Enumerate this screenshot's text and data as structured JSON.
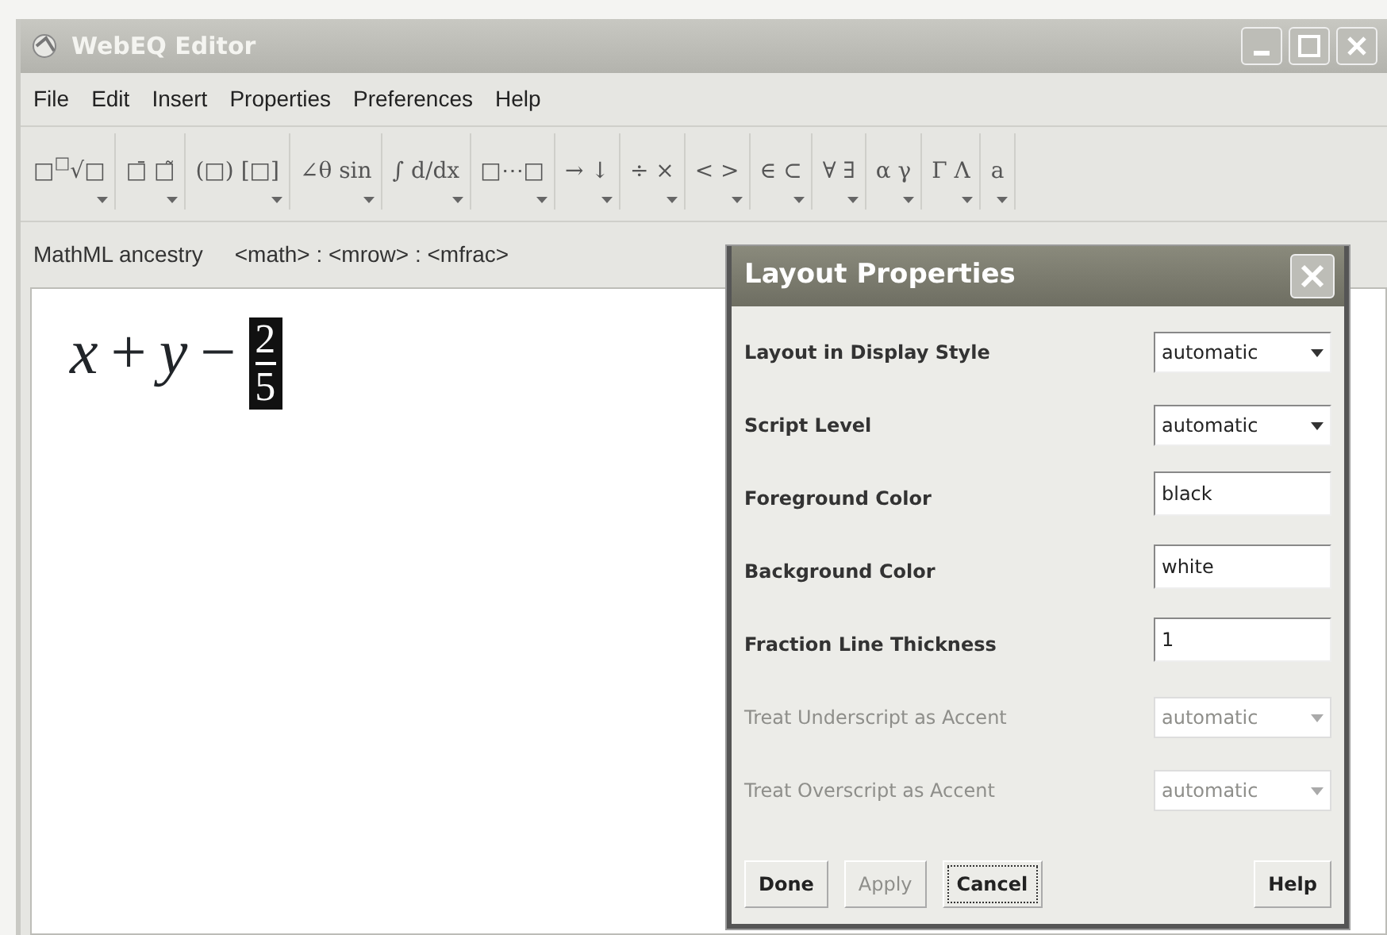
{
  "window": {
    "title": "WebEQ Editor"
  },
  "menu": [
    "File",
    "Edit",
    "Insert",
    "Properties",
    "Preferences",
    "Help"
  ],
  "toolbar": [
    {
      "label": "□$^{□}$√□"
    },
    {
      "label": "□̄ □̃"
    },
    {
      "label": "(□) [□]"
    },
    {
      "label": "∠θ sin"
    },
    {
      "label": "∫ d/dx"
    },
    {
      "label": "□⋯□"
    },
    {
      "label": "→ ↓"
    },
    {
      "label": "÷ ×"
    },
    {
      "label": "< >"
    },
    {
      "label": "∈ ⊂"
    },
    {
      "label": "∀ ∃"
    },
    {
      "label": "α γ"
    },
    {
      "label": "Γ Λ"
    },
    {
      "label": "a"
    }
  ],
  "ancestry": {
    "label": "MathML ancestry",
    "path": "<math> : <mrow> : <mfrac>"
  },
  "editor": {
    "terms": [
      {
        "kind": "variable",
        "text": "x"
      },
      {
        "kind": "operator",
        "text": "+"
      },
      {
        "kind": "variable",
        "text": "y"
      },
      {
        "kind": "operator",
        "text": "−"
      }
    ],
    "fraction": {
      "numerator": "2",
      "denominator": "5",
      "selected": true
    }
  },
  "dialog": {
    "title": "Layout Properties",
    "rows": [
      {
        "label": "Layout in Display Style",
        "kind": "select",
        "value": "automatic",
        "disabled": false
      },
      {
        "label": "Script Level",
        "kind": "select",
        "value": "automatic",
        "disabled": false
      },
      {
        "label": "Foreground Color",
        "kind": "text",
        "value": "black",
        "disabled": false
      },
      {
        "label": "Background Color",
        "kind": "text",
        "value": "white",
        "disabled": false
      },
      {
        "label": "Fraction Line Thickness",
        "kind": "text",
        "value": "1",
        "disabled": false
      },
      {
        "label": "Treat Underscript as Accent",
        "kind": "select",
        "value": "automatic",
        "disabled": true
      },
      {
        "label": "Treat Overscript as Accent",
        "kind": "select",
        "value": "automatic",
        "disabled": true
      }
    ],
    "buttons": [
      {
        "label": "Done",
        "disabled": false,
        "focused": false
      },
      {
        "label": "Apply",
        "disabled": true,
        "focused": false
      },
      {
        "label": "Cancel",
        "disabled": false,
        "focused": true
      },
      {
        "label": "Help",
        "disabled": false,
        "focused": false
      }
    ]
  }
}
